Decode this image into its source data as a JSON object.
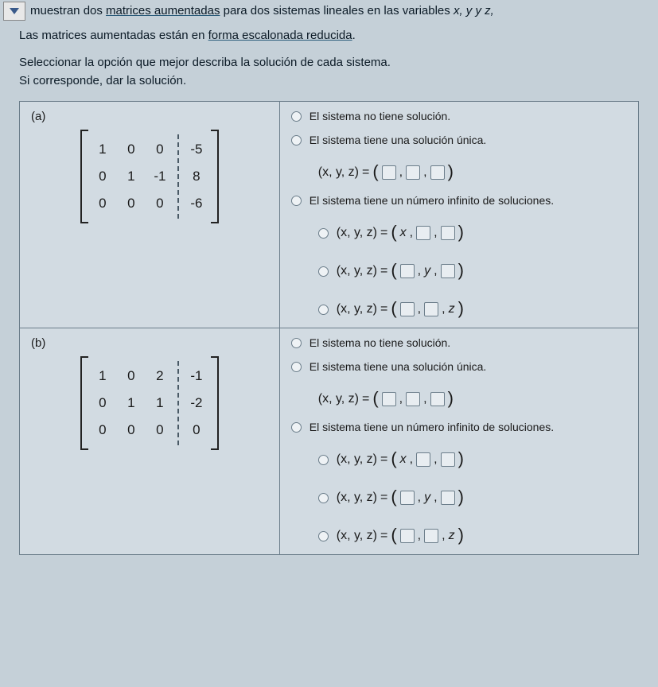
{
  "intro": {
    "line1_a": "muestran dos ",
    "link1": "matrices aumentadas",
    "line1_b": " para dos sistemas lineales en las variables ",
    "vars": "x, y y z,",
    "line2_a": "Las matrices aumentadas están en ",
    "link2": "forma escalonada reducida",
    "period": "."
  },
  "instructions": {
    "line1": "Seleccionar la opción que mejor describa la solución de cada sistema.",
    "line2": "Si corresponde, dar la solución."
  },
  "parts": {
    "a": {
      "label": "(a)",
      "matrix": {
        "c1": [
          "1",
          "0",
          "0"
        ],
        "c2": [
          "0",
          "1",
          "0"
        ],
        "c3": [
          "0",
          "-1",
          "0"
        ],
        "aug": [
          "-5",
          "8",
          "-6"
        ]
      }
    },
    "b": {
      "label": "(b)",
      "matrix": {
        "c1": [
          "1",
          "0",
          "0"
        ],
        "c2": [
          "0",
          "1",
          "0"
        ],
        "c3": [
          "2",
          "1",
          "0"
        ],
        "aug": [
          "-1",
          "-2",
          "0"
        ]
      }
    }
  },
  "options": {
    "no_sol": "El sistema no tiene solución.",
    "unique": "El sistema tiene una solución única.",
    "infinite": "El sistema tiene un número infinito de soluciones.",
    "xyz": "(x, y, z)",
    "eq": " = ",
    "x_free": "x",
    "y_free": "y",
    "z_free": "z",
    "comma": ", "
  }
}
